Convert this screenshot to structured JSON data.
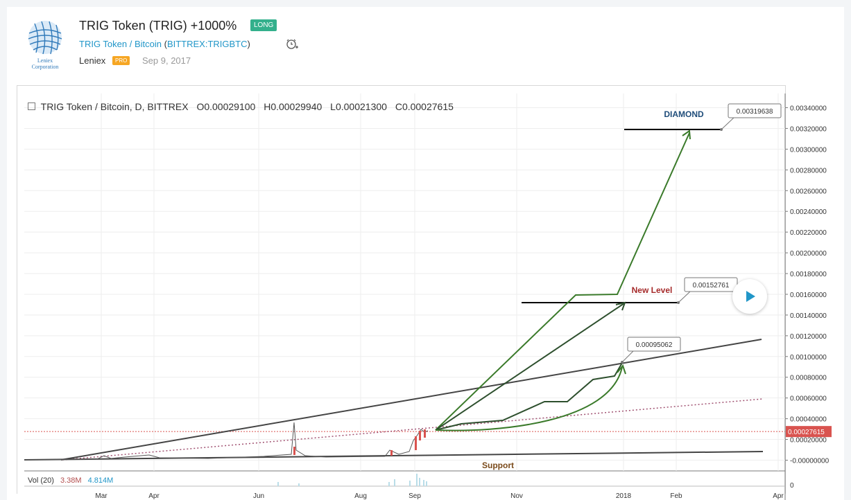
{
  "header": {
    "title": "TRIG Token (TRIG) +1000%",
    "badge": "LONG",
    "symbol_name": "TRIG Token / Bitcoin",
    "symbol_exchange": "BITTREX:TRIGBTC",
    "author": "Leniex",
    "author_badge": "PRO",
    "date": "Sep 9, 2017",
    "logo_text_1": "Leniex",
    "logo_text_2": "Corporation"
  },
  "legend": {
    "symbol": "TRIG Token / Bitcoin, D, BITTREX",
    "open": "O0.00029100",
    "high": "H0.00029940",
    "low": "L0.00021300",
    "close": "C0.00027615"
  },
  "volume": {
    "label": "Vol (20)",
    "value1": "3.38M",
    "value2": "4.814M"
  },
  "chart_data": {
    "type": "line",
    "title": "TRIG Token / Bitcoin, D, BITTREX",
    "ylim": [
      0,
      0.0034
    ],
    "y_ticks": [
      "0.00340000",
      "0.00320000",
      "0.00300000",
      "0.00280000",
      "0.00260000",
      "0.00240000",
      "0.00220000",
      "0.00200000",
      "0.00180000",
      "0.00160000",
      "0.00140000",
      "0.00120000",
      "0.00100000",
      "0.00080000",
      "0.00060000",
      "0.00040000",
      "0.00020000",
      "-0.00000000"
    ],
    "x_ticks": [
      "Mar",
      "Apr",
      "Jun",
      "Aug",
      "Sep",
      "Nov",
      "2018",
      "Feb",
      "Apr"
    ],
    "current_price": "0.00027615",
    "volume_axis_label": "0",
    "annotations": [
      {
        "text": "DIAMOND",
        "price": 0.0032
      },
      {
        "text": "New Level",
        "price": 0.00153
      },
      {
        "text": "Support",
        "price": 0.0
      }
    ],
    "price_labels": [
      "0.00319638",
      "0.00152761",
      "0.00095062"
    ],
    "colors": {
      "arrows": "#3a7a2a",
      "close_line": "#d9534f",
      "trend": "#444444",
      "dotted": "#a05070"
    }
  }
}
